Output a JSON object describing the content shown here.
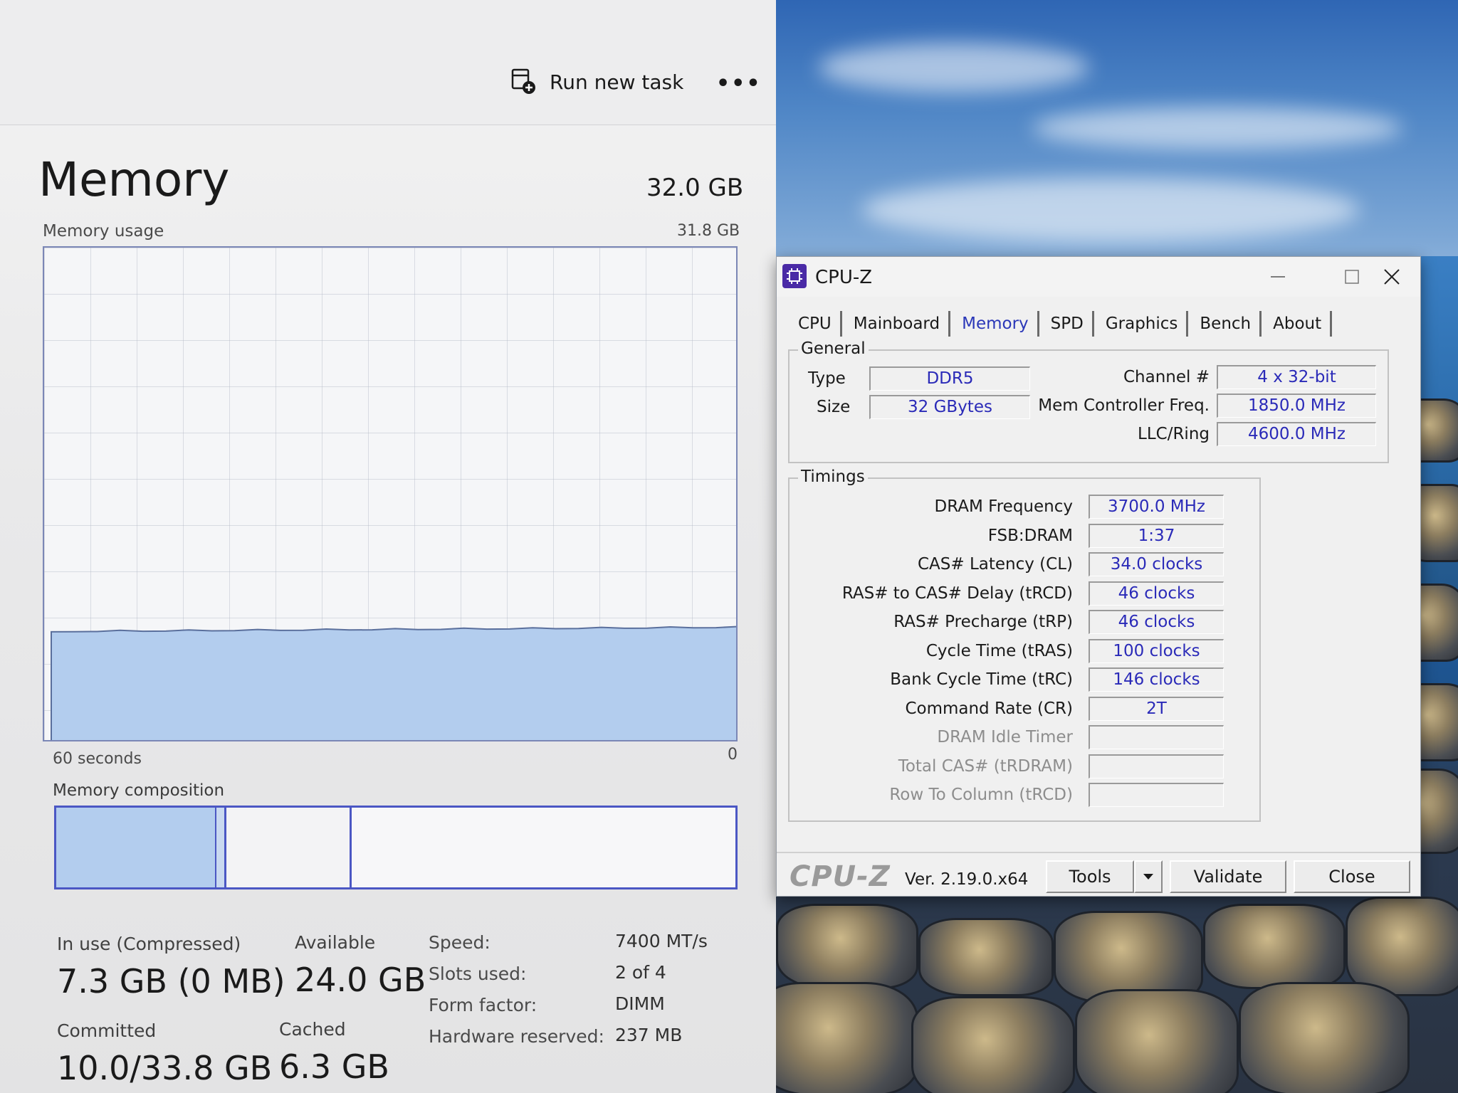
{
  "taskmgr": {
    "run_new_task": "Run new task",
    "more": "•••",
    "title": "Memory",
    "total": "32.0 GB",
    "usage_label": "Memory usage",
    "usage_max": "31.8 GB",
    "axis_left": "60 seconds",
    "axis_right": "0",
    "composition_label": "Memory composition",
    "in_use_label": "In use (Compressed)",
    "in_use_value": "7.3 GB (0 MB)",
    "available_label": "Available",
    "available_value": "24.0 GB",
    "committed_label": "Committed",
    "committed_value": "10.0/33.8 GB",
    "cached_label": "Cached",
    "cached_value": "6.3 GB",
    "speed_label": "Speed:",
    "speed_value": "7400 MT/s",
    "slots_label": "Slots used:",
    "slots_value": "2 of 4",
    "form_label": "Form factor:",
    "form_value": "DIMM",
    "hwres_label": "Hardware reserved:",
    "hwres_value": "237 MB",
    "usage_fraction": 0.23,
    "accent_color": "#4b57c4",
    "fill_color": "#b3cdee"
  },
  "cpuz": {
    "title": "CPU-Z",
    "tabs": [
      "CPU",
      "Mainboard",
      "Memory",
      "SPD",
      "Graphics",
      "Bench",
      "About"
    ],
    "active_tab": "Memory",
    "general": {
      "title": "General",
      "type_label": "Type",
      "type_value": "DDR5",
      "size_label": "Size",
      "size_value": "32 GBytes",
      "channel_label": "Channel #",
      "channel_value": "4 x 32-bit",
      "mcf_label": "Mem Controller Freq.",
      "mcf_value": "1850.0 MHz",
      "llc_label": "LLC/Ring",
      "llc_value": "4600.0 MHz"
    },
    "timings": {
      "title": "Timings",
      "rows": [
        {
          "label": "DRAM Frequency",
          "value": "3700.0 MHz"
        },
        {
          "label": "FSB:DRAM",
          "value": "1:37"
        },
        {
          "label": "CAS# Latency (CL)",
          "value": "34.0 clocks"
        },
        {
          "label": "RAS# to CAS# Delay (tRCD)",
          "value": "46 clocks"
        },
        {
          "label": "RAS# Precharge (tRP)",
          "value": "46 clocks"
        },
        {
          "label": "Cycle Time (tRAS)",
          "value": "100 clocks"
        },
        {
          "label": "Bank Cycle Time (tRC)",
          "value": "146 clocks"
        },
        {
          "label": "Command Rate (CR)",
          "value": "2T"
        },
        {
          "label": "DRAM Idle Timer",
          "value": ""
        },
        {
          "label": "Total CAS# (tRDRAM)",
          "value": ""
        },
        {
          "label": "Row To Column (tRCD)",
          "value": ""
        }
      ]
    },
    "footer": {
      "logo": "CPU-Z",
      "version": "Ver. 2.19.0.x64",
      "tools": "Tools",
      "validate": "Validate",
      "close": "Close"
    },
    "icon_color": "#4a2aa6",
    "value_color": "#2a2ab8"
  }
}
